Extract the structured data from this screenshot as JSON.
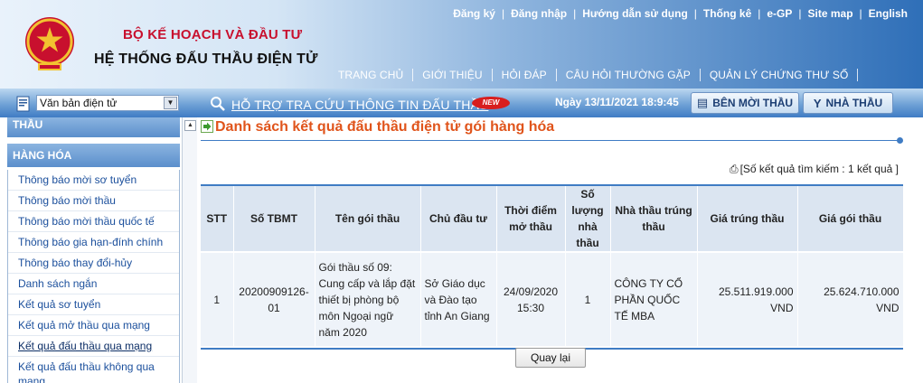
{
  "header": {
    "ministry": "BỘ KẾ HOẠCH VÀ ĐẦU TƯ",
    "system": "HỆ THỐNG ĐẤU THẦU ĐIỆN TỬ",
    "top_links": [
      "Đăng ký",
      "Đăng nhập",
      "Hướng dẫn sử dụng",
      "Thống kê",
      "e-GP",
      "Site map",
      "English"
    ],
    "main_nav": [
      "TRANG CHỦ",
      "GIỚI THIỆU",
      "HỎI ĐÁP",
      "CÂU HỎI THƯỜNG GẶP",
      "QUẢN LÝ CHỨNG THƯ SỐ"
    ]
  },
  "subbar": {
    "select_value": "Văn bản điện tử",
    "support_link": "HỖ TRỢ TRA CỨU THÔNG TIN ĐẤU THẦU",
    "new_badge": "NEW",
    "date": "Ngày 13/11/2021 18:9:45",
    "btn_bid": "BÊN MỜI THẦU",
    "btn_contractor": "NHÀ THẦU"
  },
  "sidebar": {
    "cat_top": "THẦU",
    "cat_goods": "HÀNG HÓA",
    "items": [
      "Thông báo mời sơ tuyển",
      "Thông báo mời thầu",
      "Thông báo mời thầu quốc tế",
      "Thông báo gia hạn-đính chính",
      "Thông báo thay đổi-hủy",
      "Danh sách ngắn",
      "Kết quả sơ tuyển",
      "Kết quả mở thầu qua mạng",
      "Kết quả đấu thầu qua mạng",
      "Kết quả đấu thầu không qua mạng"
    ]
  },
  "content": {
    "title": "Danh sách kết quả đấu thầu điện tử gói hàng hóa",
    "result_count": "[Số kết quả tìm kiếm : 1 kết quả ]",
    "columns": [
      "STT",
      "Số TBMT",
      "Tên gói thầu",
      "Chủ đầu tư",
      "Thời điểm mở thầu",
      "Số lượng nhà thầu",
      "Nhà thầu trúng thầu",
      "Giá trúng thầu",
      "Giá gói thầu"
    ],
    "rows": [
      {
        "stt": "1",
        "tbmt": "20200909126-01",
        "package": "Gói thầu số 09: Cung cấp và lắp đặt thiết bị phòng bộ môn Ngoại ngữ năm 2020",
        "investor": "Sở Giáo dục và Đào tạo tỉnh An Giang",
        "opening": "24/09/2020 15:30",
        "bidders": "1",
        "winner": "CÔNG TY CỔ PHẦN QUỐC TẾ MBA",
        "winning_price": "25.511.919.000 VND",
        "package_price": "25.624.710.000 VND"
      }
    ],
    "back_button": "Quay lại"
  },
  "colors": {
    "accent": "#3f7cc4",
    "title": "#e0541b",
    "ministry": "#c8102e",
    "link": "#1b4f9c"
  }
}
